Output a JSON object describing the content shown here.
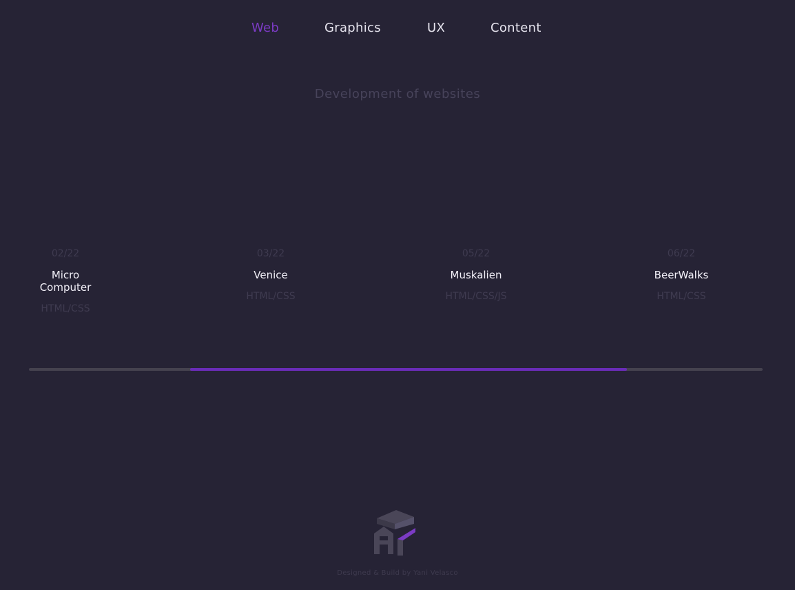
{
  "nav": {
    "items": [
      {
        "label": "Web",
        "active": true
      },
      {
        "label": "Graphics",
        "active": false
      },
      {
        "label": "UX",
        "active": false
      },
      {
        "label": "Content",
        "active": false
      }
    ]
  },
  "section": {
    "subtitle": "Development of websites"
  },
  "projects": [
    {
      "date": "02/22",
      "name": "Micro Computer",
      "tech": "HTML/CSS"
    },
    {
      "date": "03/22",
      "name": "Venice",
      "tech": "HTML/CSS"
    },
    {
      "date": "05/22",
      "name": "Muskalien",
      "tech": "HTML/CSS/JS"
    },
    {
      "date": "06/22",
      "name": "BeerWalks",
      "tech": "HTML/CSS"
    }
  ],
  "scrollbar": {
    "position": 0.22,
    "visible_fraction": 0.595
  },
  "footer": {
    "credit": "Designed & Build by Yani Velasco"
  },
  "colors": {
    "background": "#262335",
    "accent": "#7b3bc4",
    "muted": "#47435a"
  }
}
